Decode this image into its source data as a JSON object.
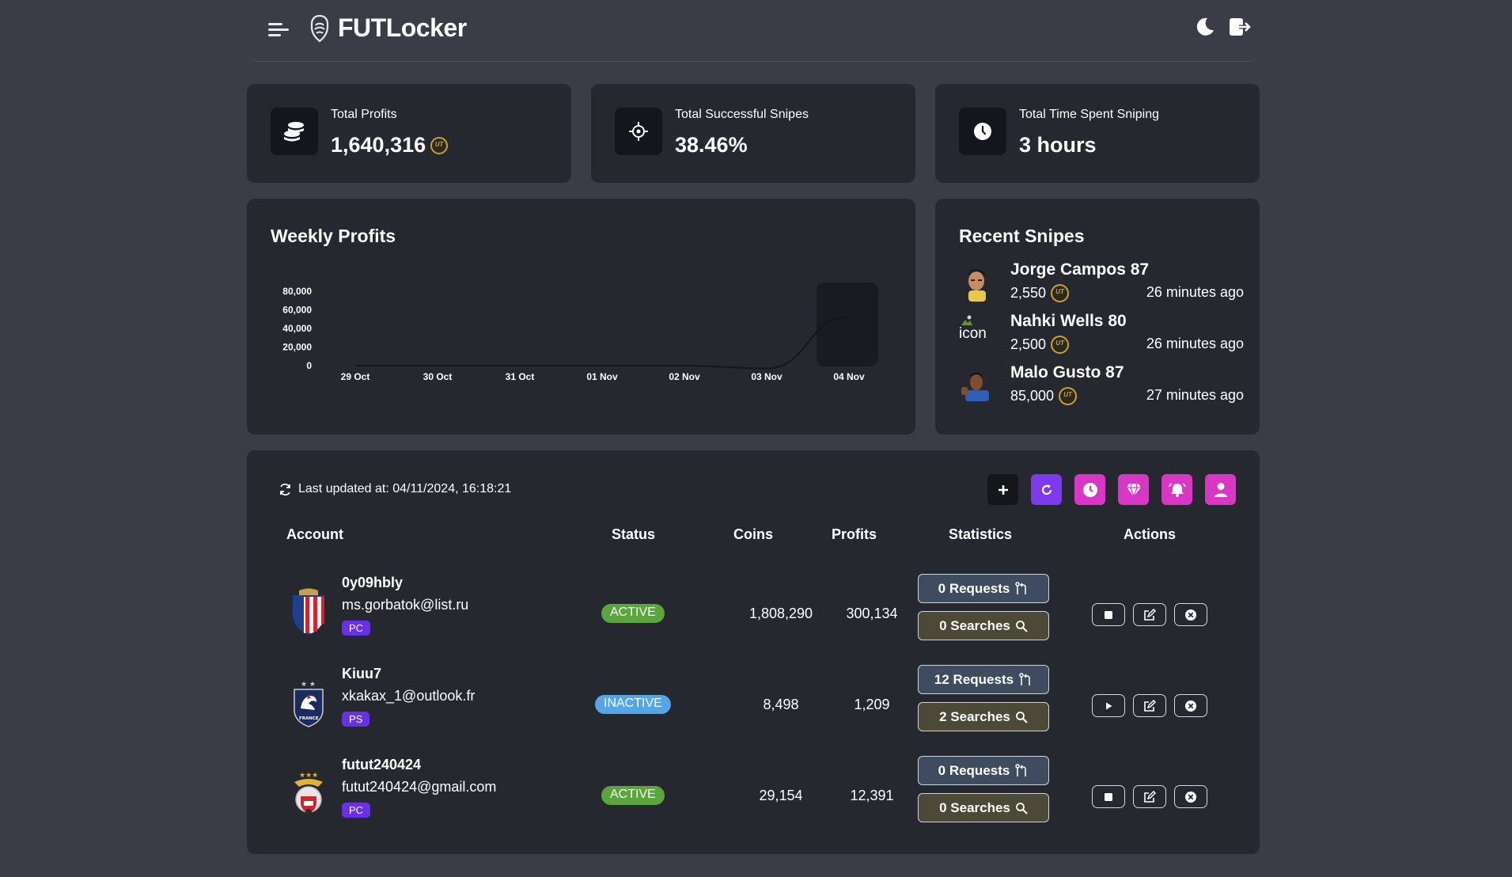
{
  "app": {
    "title": "FUTLocker"
  },
  "colors": {
    "accent_purple": "#7c3aed",
    "accent_pink": "#d936c6",
    "active": "#5aa63c",
    "inactive": "#54a6e6",
    "gold": "#c9a227"
  },
  "stats": [
    {
      "label": "Total Profits",
      "value": "1,640,316",
      "icon": "coins-icon"
    },
    {
      "label": "Total Successful Snipes",
      "value": "38.46%",
      "icon": "crosshair-icon"
    },
    {
      "label": "Total Time Spent Sniping",
      "value": "3 hours",
      "icon": "clock-icon"
    }
  ],
  "weekly": {
    "title": "Weekly Profits"
  },
  "chart_data": {
    "type": "line",
    "title": "Weekly Profits",
    "categories": [
      "29 Oct",
      "30 Oct",
      "31 Oct",
      "01 Nov",
      "02 Nov",
      "03 Nov",
      "04 Nov"
    ],
    "series": [
      {
        "values": [
          0,
          0,
          0,
          0,
          0,
          -3000,
          52000
        ]
      }
    ],
    "y_ticks": [
      "80,000",
      "60,000",
      "40,000",
      "20,000",
      "0"
    ],
    "ylim": [
      0,
      80000
    ],
    "grid": false
  },
  "recent": {
    "title": "Recent Snipes",
    "items": [
      {
        "name": "Jorge Campos 87",
        "price": "2,550",
        "time": "26 minutes ago",
        "avatar": "player-photo"
      },
      {
        "name": "Nahki Wells 80",
        "price": "2,500",
        "time": "26 minutes ago",
        "avatar": "broken-image",
        "alt": "icon"
      },
      {
        "name": "Malo Gusto 87",
        "price": "85,000",
        "time": "27 minutes ago",
        "avatar": "player-photo"
      }
    ]
  },
  "table": {
    "updated": "Last updated at: 04/11/2024, 16:18:21",
    "headers": {
      "account": "Account",
      "status": "Status",
      "coins": "Coins",
      "profits": "Profits",
      "statistics": "Statistics",
      "actions": "Actions"
    },
    "rows": [
      {
        "name": "0y09hbly",
        "email": "ms.gorbatok@list.ru",
        "platform": "PC",
        "status": "ACTIVE",
        "coins": "1,808,290",
        "profits": "300,134",
        "requests": "0 Requests",
        "searches": "0 Searches",
        "crest": "atletico-crest"
      },
      {
        "name": "Kiuu7",
        "email": "xkakax_1@outlook.fr",
        "platform": "PS",
        "status": "INACTIVE",
        "coins": "8,498",
        "profits": "1,209",
        "requests": "12 Requests",
        "searches": "2 Searches",
        "crest": "france-crest"
      },
      {
        "name": "futut240424",
        "email": "futut240424@gmail.com",
        "platform": "PC",
        "status": "ACTIVE",
        "coins": "29,154",
        "profits": "12,391",
        "requests": "0 Requests",
        "searches": "0 Searches",
        "crest": "benfica-crest"
      }
    ]
  }
}
